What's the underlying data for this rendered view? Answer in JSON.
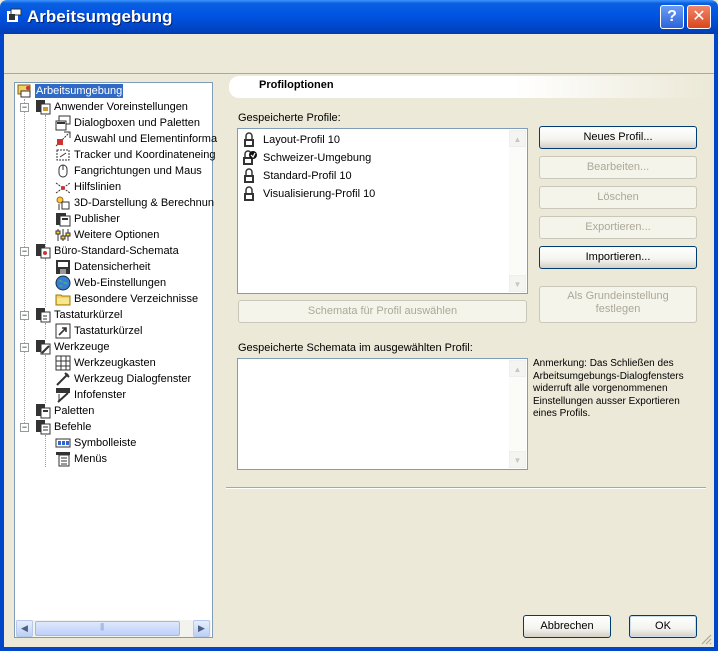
{
  "window": {
    "title": "Arbeitsumgebung",
    "help_label": "?",
    "close_label": "✕"
  },
  "tree": {
    "items": [
      {
        "label": "Arbeitsumgebung",
        "icon": "workspace-icon"
      },
      {
        "label": "Anwender Voreinstellungen",
        "icon": "user-settings-icon"
      },
      {
        "label": "Dialogboxen und Paletten",
        "icon": "dialog-palette-icon"
      },
      {
        "label": "Auswahl und Elementinforma",
        "icon": "selection-icon"
      },
      {
        "label": "Tracker und Koordinateneing",
        "icon": "tracker-icon"
      },
      {
        "label": "Fangrichtungen und Maus",
        "icon": "mouse-icon"
      },
      {
        "label": "Hilfslinien",
        "icon": "guide-lines-icon"
      },
      {
        "label": "3D-Darstellung & Berechnun",
        "icon": "3d-render-icon"
      },
      {
        "label": "Publisher",
        "icon": "publisher-icon"
      },
      {
        "label": "Weitere Optionen",
        "icon": "more-options-icon"
      },
      {
        "label": "Büro-Standard-Schemata",
        "icon": "office-schemes-icon"
      },
      {
        "label": "Datensicherheit",
        "icon": "data-security-icon"
      },
      {
        "label": "Web-Einstellungen",
        "icon": "globe-icon"
      },
      {
        "label": "Besondere Verzeichnisse",
        "icon": "folder-icon"
      },
      {
        "label": "Tastaturkürzel",
        "icon": "keyboard-icon"
      },
      {
        "label": "Tastaturkürzel",
        "icon": "shortcut-icon"
      },
      {
        "label": "Werkzeuge",
        "icon": "tools-icon"
      },
      {
        "label": "Werkzeugkasten",
        "icon": "toolbox-icon"
      },
      {
        "label": "Werkzeug Dialogfenster",
        "icon": "tool-dialog-icon"
      },
      {
        "label": "Infofenster",
        "icon": "info-window-icon"
      },
      {
        "label": "Paletten",
        "icon": "palettes-icon"
      },
      {
        "label": "Befehle",
        "icon": "commands-icon"
      },
      {
        "label": "Symbolleiste",
        "icon": "toolbar-icon"
      },
      {
        "label": "Menüs",
        "icon": "menus-icon"
      }
    ],
    "scroll_grip": "|||"
  },
  "panel": {
    "header": "Profiloptionen",
    "saved_profiles_label": "Gespeicherte Profile:",
    "profiles": [
      {
        "label": "Layout-Profil 10",
        "icon": "lock-icon"
      },
      {
        "label": "Schweizer-Umgebung",
        "icon": "lock-check-icon"
      },
      {
        "label": "Standard-Profil 10",
        "icon": "lock-icon"
      },
      {
        "label": "Visualisierung-Profil 10",
        "icon": "lock-icon"
      }
    ],
    "schemes_button": "Schemata für Profil auswählen",
    "saved_schemes_label": "Gespeicherte Schemata im ausgewählten Profil:",
    "note": "Anmerkung: Das Schließen des Arbeitsumgebungs-Dialogfensters widerruft alle vorgenommenen Einstellungen ausser Exportieren eines Profils."
  },
  "buttons": {
    "new_profile": "Neues Profil...",
    "edit": "Bearbeiten...",
    "delete": "Löschen",
    "export": "Exportieren...",
    "import": "Importieren...",
    "default_line1": "Als Grundeinstellung",
    "default_line2": "festlegen",
    "cancel": "Abbrechen",
    "ok": "OK"
  },
  "colors": {
    "titlebar": "#0054e3",
    "selection": "#316ac5",
    "dialog_bg": "#ece9d8",
    "disabled_text": "#aca899"
  }
}
